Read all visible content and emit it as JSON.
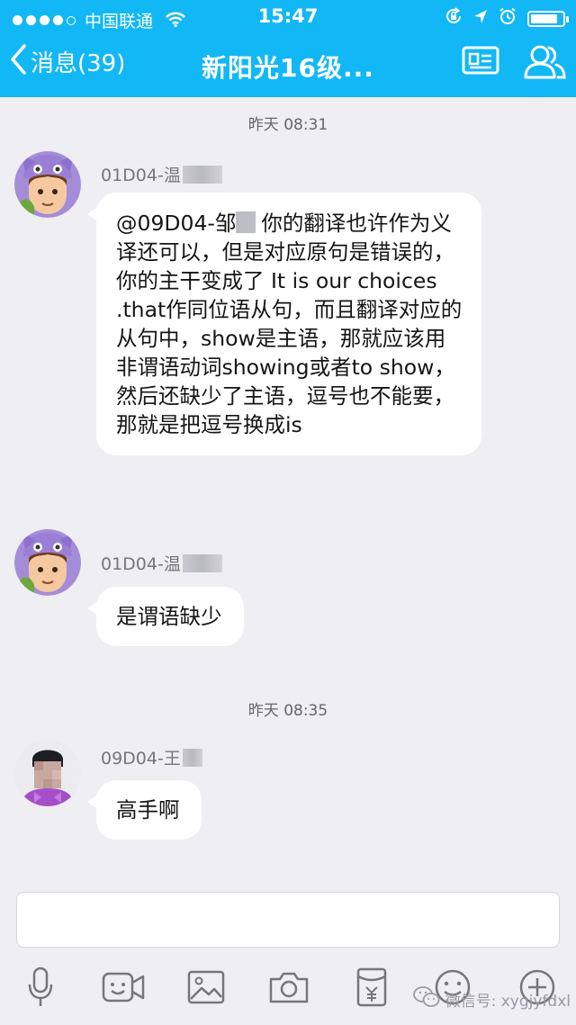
{
  "status_bar": {
    "carrier": "中国联通",
    "time": "15:47",
    "battery_level": 0.85
  },
  "nav": {
    "back_label": "消息(39)",
    "title": "新阳光16级..."
  },
  "messages": [
    {
      "timestamp": "昨天 08:31",
      "sender": "01D04-温",
      "text_prefix": "@09D04-邹",
      "text": "你的翻译也许作为义译还可以，但是对应原句是错误的，你的主干变成了 It is our  choices .that作同位语从句，而且翻译对应的从句中，show是主语，那就应该用非谓语动词showing或者to show，然后还缺少了主语，逗号也不能要，那就是把逗号换成is"
    },
    {
      "sender": "01D04-温",
      "text": "是谓语缺少"
    },
    {
      "timestamp": "昨天 08:35",
      "sender": "09D04-王",
      "text": "高手啊"
    }
  ],
  "input": {
    "placeholder": ""
  },
  "toolbar": {
    "icons": [
      "microphone-icon",
      "video-icon",
      "image-icon",
      "camera-icon",
      "red-packet-icon",
      "emoji-icon",
      "plus-icon"
    ]
  },
  "watermark": {
    "text": "微信号: xygjyfdxl"
  },
  "colors": {
    "nav_bar": "#12b7f5",
    "background": "#eeeef3",
    "bubble": "#ffffff"
  }
}
